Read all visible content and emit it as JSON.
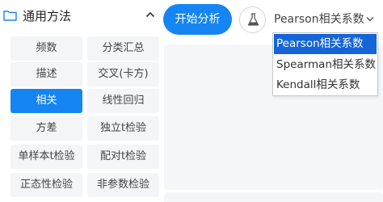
{
  "category": {
    "title": "通用方法",
    "icon": "folder-icon",
    "toggle_icon": "chevron-up-icon"
  },
  "methods": [
    {
      "label": "频数",
      "active": false
    },
    {
      "label": "分类汇总",
      "active": false
    },
    {
      "label": "描述",
      "active": false
    },
    {
      "label": "交叉(卡方)",
      "active": false
    },
    {
      "label": "相关",
      "active": true
    },
    {
      "label": "线性回归",
      "active": false
    },
    {
      "label": "方差",
      "active": false
    },
    {
      "label": "独立t检验",
      "active": false
    },
    {
      "label": "单样本t检验",
      "active": false
    },
    {
      "label": "配对t检验",
      "active": false
    },
    {
      "label": "正态性检验",
      "active": false
    },
    {
      "label": "非参数检验",
      "active": false
    }
  ],
  "toolbar": {
    "start_label": "开始分析",
    "flask_icon": "flask-icon"
  },
  "correlation_select": {
    "value": "Pearson相关系数",
    "caret_icon": "chevron-down-icon",
    "options": [
      "Pearson相关系数",
      "Spearman相关系数",
      "Kendall相关系数"
    ],
    "selected_index": 0
  },
  "colors": {
    "accent": "#1585f3",
    "option_highlight": "#1565d8",
    "cell_bg": "#f4f5f7",
    "panel_bg": "#f5f6f8"
  }
}
